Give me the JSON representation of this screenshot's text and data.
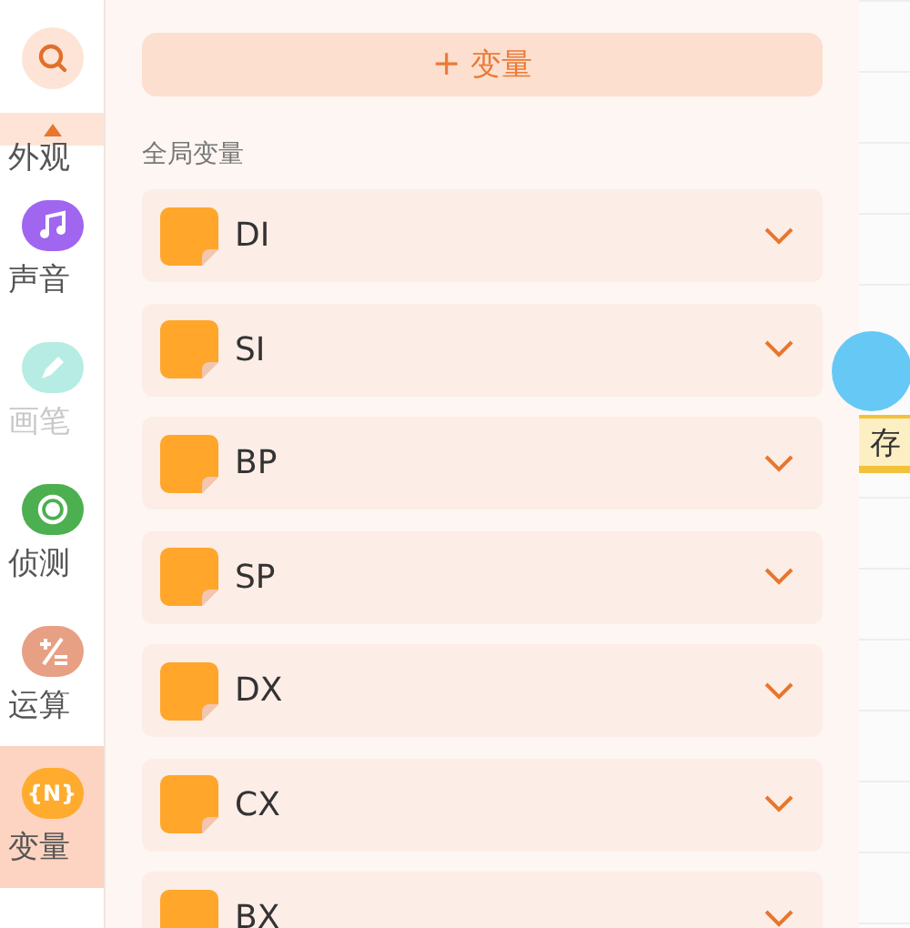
{
  "sidebar": {
    "items": [
      {
        "label": "外观",
        "selected": false,
        "disabled": false
      },
      {
        "label": "声音",
        "kind": "sound",
        "color": "#a066f0",
        "selected": false,
        "disabled": false
      },
      {
        "label": "画笔",
        "kind": "pen",
        "color": "#b6ece3",
        "selected": false,
        "disabled": true
      },
      {
        "label": "侦测",
        "kind": "sensing",
        "color": "#4caf50",
        "selected": false,
        "disabled": false
      },
      {
        "label": "运算",
        "kind": "operators",
        "color": "#e8a085",
        "selected": false,
        "disabled": false
      },
      {
        "label": "变量",
        "kind": "variables",
        "color": "#ffab2e",
        "selected": true,
        "disabled": false,
        "icon_text": "{N}"
      }
    ]
  },
  "panel": {
    "add_button": {
      "icon": "+",
      "label": "变量"
    },
    "heading": "全局变量",
    "variables": [
      {
        "name": "DI"
      },
      {
        "name": "SI"
      },
      {
        "name": "BP"
      },
      {
        "name": "SP"
      },
      {
        "name": "DX"
      },
      {
        "name": "CX"
      },
      {
        "name": "BX"
      }
    ]
  },
  "canvas": {
    "block_label": "存"
  }
}
